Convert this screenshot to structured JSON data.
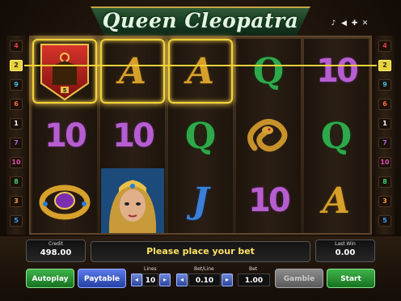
{
  "title": "Queen Cleopatra",
  "sys_icons": [
    "music-note-icon",
    "speaker-icon",
    "settings-icon",
    "close-icon"
  ],
  "left_lines": [
    "4",
    "2",
    "9",
    "6",
    "1",
    "7",
    "10",
    "8",
    "3",
    "5"
  ],
  "right_lines": [
    "4",
    "2",
    "9",
    "6",
    "1",
    "7",
    "10",
    "8",
    "3",
    "5"
  ],
  "active_line": "2",
  "reels": [
    [
      "sarcophagus-icon",
      "10",
      "ring-icon"
    ],
    [
      "A",
      "10",
      "cleopatra-icon"
    ],
    [
      "A",
      "Q",
      "J"
    ],
    [
      "Q",
      "snake-icon",
      "10"
    ],
    [
      "10",
      "Q",
      "A"
    ]
  ],
  "winning_cells": [
    [
      0,
      0
    ],
    [
      1,
      0
    ],
    [
      2,
      0
    ]
  ],
  "win_badge": "5",
  "bottom": {
    "credit_label": "Credit",
    "credit_value": "498.00",
    "message": "Please place your bet",
    "last_win_label": "Last Win",
    "last_win_value": "0.00",
    "lines_label": "Lines",
    "lines_value": "10",
    "bet_line_label": "Bet/Line",
    "bet_line_value": "0.10",
    "bet_label": "Bet",
    "bet_value": "1.00",
    "autoplay_label": "Autoplay",
    "paytable_label": "Paytable",
    "gamble_label": "Gamble",
    "start_label": "Start"
  },
  "colors": {
    "highlight": "#f0d23a",
    "ten": "#b65ed0",
    "queen": "#2ea84a",
    "jack": "#3c7fd6",
    "ace": "#d6a02a"
  }
}
